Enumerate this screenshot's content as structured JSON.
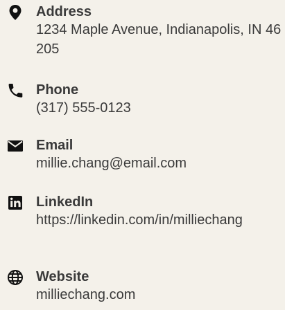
{
  "contact": {
    "items": [
      {
        "label": "Address",
        "value": "1234 Maple Avenue, Indianapolis, IN 46205",
        "icon": "location-pin-icon"
      },
      {
        "label": "Phone",
        "value": "(317) 555-0123",
        "icon": "phone-icon"
      },
      {
        "label": "Email",
        "value": "millie.chang@email.com",
        "icon": "envelope-icon"
      },
      {
        "label": "LinkedIn",
        "value": "https://linkedin.com/in/milliechang",
        "icon": "linkedin-icon"
      },
      {
        "label": "Website",
        "value": "milliechang.com",
        "icon": "globe-icon"
      }
    ],
    "colors": {
      "text": "#3a3a3a",
      "icon": "#111111",
      "background": "#f4f1ea"
    }
  }
}
